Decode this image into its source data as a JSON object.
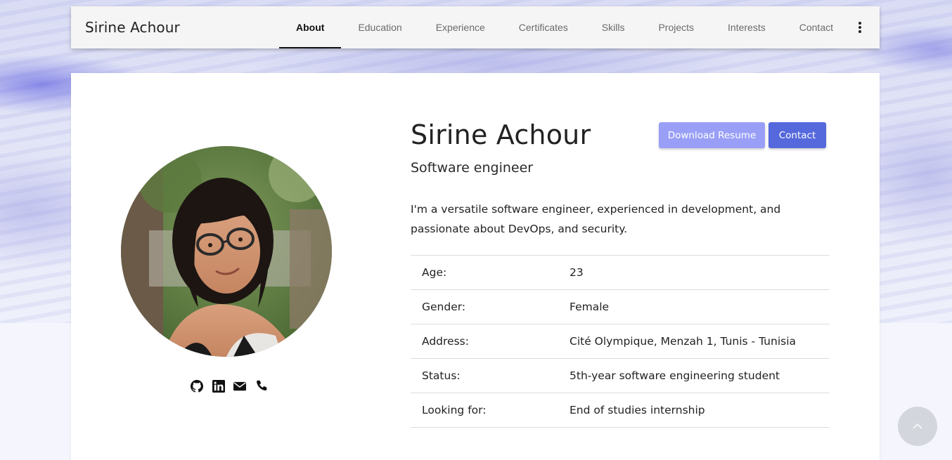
{
  "brand": "Sirine Achour",
  "nav": {
    "tabs": [
      {
        "label": "About",
        "active": true
      },
      {
        "label": "Education",
        "active": false
      },
      {
        "label": "Experience",
        "active": false
      },
      {
        "label": "Certificates",
        "active": false
      },
      {
        "label": "Skills",
        "active": false
      },
      {
        "label": "Projects",
        "active": false
      },
      {
        "label": "Interests",
        "active": false
      },
      {
        "label": "Contact",
        "active": false
      }
    ],
    "more_icon": "more-vertical-icon"
  },
  "profile": {
    "name": "Sirine Achour",
    "title": "Software engineer",
    "bio": "I'm a versatile software engineer, experienced in development, and passionate about DevOps, and security.",
    "photo_icon": "profile-photo"
  },
  "buttons": {
    "download_resume": "Download Resume",
    "contact": "Contact"
  },
  "social": [
    "github-icon",
    "linkedin-icon",
    "envelope-icon",
    "phone-icon"
  ],
  "info": [
    {
      "label": "Age:",
      "value": "23"
    },
    {
      "label": "Gender:",
      "value": "Female"
    },
    {
      "label": "Address:",
      "value": "Cité Olympique, Menzah 1, Tunis - Tunisia"
    },
    {
      "label": "Status:",
      "value": "5th-year software engineering student"
    },
    {
      "label": "Looking for:",
      "value": "End of studies internship"
    }
  ],
  "colors": {
    "accent": "#5568dc",
    "accent_light": "#999ff7",
    "nav_bg": "#f5f5f5"
  }
}
